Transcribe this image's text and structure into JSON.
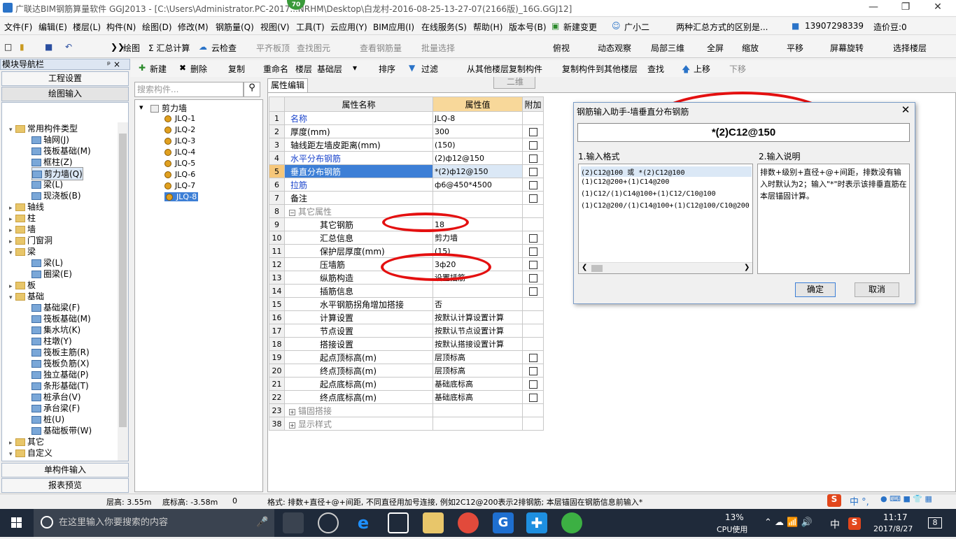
{
  "title": "广联达BIM钢筋算量软件 GGJ2013 - [C:\\Users\\Administrator.PC-2017...NRHM\\Desktop\\白龙村-2016-08-25-13-27-07(2166版)_16G.GGJ12]",
  "badge": "70",
  "menu": [
    "文件(F)",
    "编辑(E)",
    "楼层(L)",
    "构件(N)",
    "绘图(D)",
    "修改(M)",
    "钢筋量(Q)",
    "视图(V)",
    "工具(T)",
    "云应用(Y)",
    "BIM应用(I)",
    "在线服务(S)",
    "帮助(H)",
    "版本号(B)",
    "新建变更",
    "广小二",
    "两种汇总方式的区别是...",
    "13907298339",
    "造价豆:0"
  ],
  "toolbar1": [
    "绘图",
    "Σ 汇总计算",
    "云检查",
    "平齐板顶",
    "查找图元",
    "查看钢筋量",
    "批量选择",
    "二维",
    "俯视",
    "动态观察",
    "局部三维",
    "全屏",
    "缩放",
    "平移",
    "屏幕旋转",
    "选择楼层"
  ],
  "nav": {
    "header": "模块导航栏",
    "pin": "ᵖ ×",
    "btn_project": "工程设置",
    "btn_draw": "绘图输入",
    "btn_single": "单构件输入",
    "btn_report": "报表预览"
  },
  "tree": [
    {
      "label": "常用构件类型",
      "level": 0,
      "exp": "▾",
      "folder": true
    },
    {
      "label": "轴网(J)",
      "level": 1
    },
    {
      "label": "筏板基础(M)",
      "level": 1
    },
    {
      "label": "框柱(Z)",
      "level": 1
    },
    {
      "label": "剪力墙(Q)",
      "level": 1,
      "sel": true
    },
    {
      "label": "梁(L)",
      "level": 1
    },
    {
      "label": "现浇板(B)",
      "level": 1
    },
    {
      "label": "轴线",
      "level": 0,
      "exp": "▸",
      "folder": true
    },
    {
      "label": "柱",
      "level": 0,
      "exp": "▸",
      "folder": true
    },
    {
      "label": "墙",
      "level": 0,
      "exp": "▸",
      "folder": true
    },
    {
      "label": "门窗洞",
      "level": 0,
      "exp": "▸",
      "folder": true
    },
    {
      "label": "梁",
      "level": 0,
      "exp": "▾",
      "folder": true
    },
    {
      "label": "梁(L)",
      "level": 1
    },
    {
      "label": "圈梁(E)",
      "level": 1
    },
    {
      "label": "板",
      "level": 0,
      "exp": "▸",
      "folder": true
    },
    {
      "label": "基础",
      "level": 0,
      "exp": "▾",
      "folder": true
    },
    {
      "label": "基础梁(F)",
      "level": 1
    },
    {
      "label": "筏板基础(M)",
      "level": 1
    },
    {
      "label": "集水坑(K)",
      "level": 1
    },
    {
      "label": "柱墩(Y)",
      "level": 1
    },
    {
      "label": "筏板主筋(R)",
      "level": 1
    },
    {
      "label": "筏板负筋(X)",
      "level": 1
    },
    {
      "label": "独立基础(P)",
      "level": 1
    },
    {
      "label": "条形基础(T)",
      "level": 1
    },
    {
      "label": "桩承台(V)",
      "level": 1
    },
    {
      "label": "承台梁(F)",
      "level": 1
    },
    {
      "label": "桩(U)",
      "level": 1
    },
    {
      "label": "基础板带(W)",
      "level": 1
    },
    {
      "label": "其它",
      "level": 0,
      "exp": "▸",
      "folder": true
    },
    {
      "label": "自定义",
      "level": 0,
      "exp": "▾",
      "folder": true
    }
  ],
  "search_placeholder": "搜索构件...",
  "comp_root": "剪力墙",
  "components": [
    "JLQ-1",
    "JLQ-2",
    "JLQ-3",
    "JLQ-4",
    "JLQ-5",
    "JLQ-6",
    "JLQ-7",
    "JLQ-8"
  ],
  "toolbar2": [
    "新建",
    "删除",
    "复制",
    "重命名",
    "楼层",
    "基础层",
    "排序",
    "过滤",
    "从其他楼层复制构件",
    "复制构件到其他楼层",
    "查找",
    "上移",
    "下移"
  ],
  "prop_tab": "属性编辑",
  "grid_headers": {
    "name": "属性名称",
    "value": "属性值",
    "add": "附加"
  },
  "rows": [
    {
      "n": "1",
      "name": "名称",
      "val": "JLQ-8",
      "blue": true,
      "cb": false
    },
    {
      "n": "2",
      "name": "厚度(mm)",
      "val": "300",
      "cb": true
    },
    {
      "n": "3",
      "name": "轴线距左墙皮距离(mm)",
      "val": "(150)",
      "cb": true
    },
    {
      "n": "4",
      "name": "水平分布钢筋",
      "val": "(2)ф12@150",
      "blue": true,
      "cb": true
    },
    {
      "n": "5",
      "name": "垂直分布钢筋",
      "val": "*(2)ф12@150",
      "blue": true,
      "cb": true,
      "hl": true
    },
    {
      "n": "6",
      "name": "拉筋",
      "val": "ф6@450*4500",
      "blue": true,
      "cb": true
    },
    {
      "n": "7",
      "name": "备注",
      "val": "",
      "cb": true
    },
    {
      "n": "8",
      "name": "其它属性",
      "val": "",
      "group": "−"
    },
    {
      "n": "9",
      "name": "其它钢筋",
      "val": "18",
      "sub": true
    },
    {
      "n": "10",
      "name": "汇总信息",
      "val": "剪力墙",
      "sub": true,
      "cb": true
    },
    {
      "n": "11",
      "name": "保护层厚度(mm)",
      "val": "(15)",
      "sub": true,
      "cb": true
    },
    {
      "n": "12",
      "name": "压墙筋",
      "val": "3ф20",
      "sub": true,
      "cb": true
    },
    {
      "n": "13",
      "name": "纵筋构造",
      "val": "设置插筋",
      "sub": true,
      "cb": true
    },
    {
      "n": "14",
      "name": "插筋信息",
      "val": "",
      "sub": true,
      "cb": true
    },
    {
      "n": "15",
      "name": "水平钢筋拐角增加搭接",
      "val": "否",
      "sub": true
    },
    {
      "n": "16",
      "name": "计算设置",
      "val": "按默认计算设置计算",
      "sub": true
    },
    {
      "n": "17",
      "name": "节点设置",
      "val": "按默认节点设置计算",
      "sub": true
    },
    {
      "n": "18",
      "name": "搭接设置",
      "val": "按默认搭接设置计算",
      "sub": true
    },
    {
      "n": "19",
      "name": "起点顶标高(m)",
      "val": "层顶标高",
      "sub": true,
      "cb": true
    },
    {
      "n": "20",
      "name": "终点顶标高(m)",
      "val": "层顶标高",
      "sub": true,
      "cb": true
    },
    {
      "n": "21",
      "name": "起点底标高(m)",
      "val": "基础底标高",
      "sub": true,
      "cb": true
    },
    {
      "n": "22",
      "name": "终点底标高(m)",
      "val": "基础底标高",
      "sub": true,
      "cb": true
    },
    {
      "n": "23",
      "name": "锚固搭接",
      "val": "",
      "group": "+"
    },
    {
      "n": "38",
      "name": "显示样式",
      "val": "",
      "group": "+"
    }
  ],
  "dialog": {
    "title": "钢筋输入助手-墙垂直分布钢筋",
    "input": "*(2)C12@150",
    "fmt_label": "1.输入格式",
    "exp_label": "2.输入说明",
    "formats": [
      "(2)C12@100 或 *(2)C12@100",
      "(1)C12@200+(1)C14@200",
      "(1)C12/(1)C14@100+(1)C12/C10@100",
      "(1)C12@200/(1)C14@100+(1)C12@100/C10@200"
    ],
    "explanation": "排数+级别+直径+@+间距，排数没有输入时默认为2；输入\"*\"时表示该排垂直筋在本层锚固计算。",
    "ok": "确定",
    "cancel": "取消"
  },
  "status": {
    "floor_h": "层高: 3.55m",
    "bottom_h": "底标高: -3.58m",
    "zero": "0",
    "hint": "格式: 排数+直径+@+间距, 不同直径用加号连接, 例如2C12@200表示2排钢筋; 本层锚固在钢筋信息前输入*"
  },
  "taskbar": {
    "search": "在这里输入你要搜索的内容",
    "cpu": "13%",
    "cpu_label": "CPU使用",
    "ime": "中",
    "time": "11:17",
    "date": "2017/8/27",
    "notif": "8"
  },
  "ime_bar": "中 °,"
}
